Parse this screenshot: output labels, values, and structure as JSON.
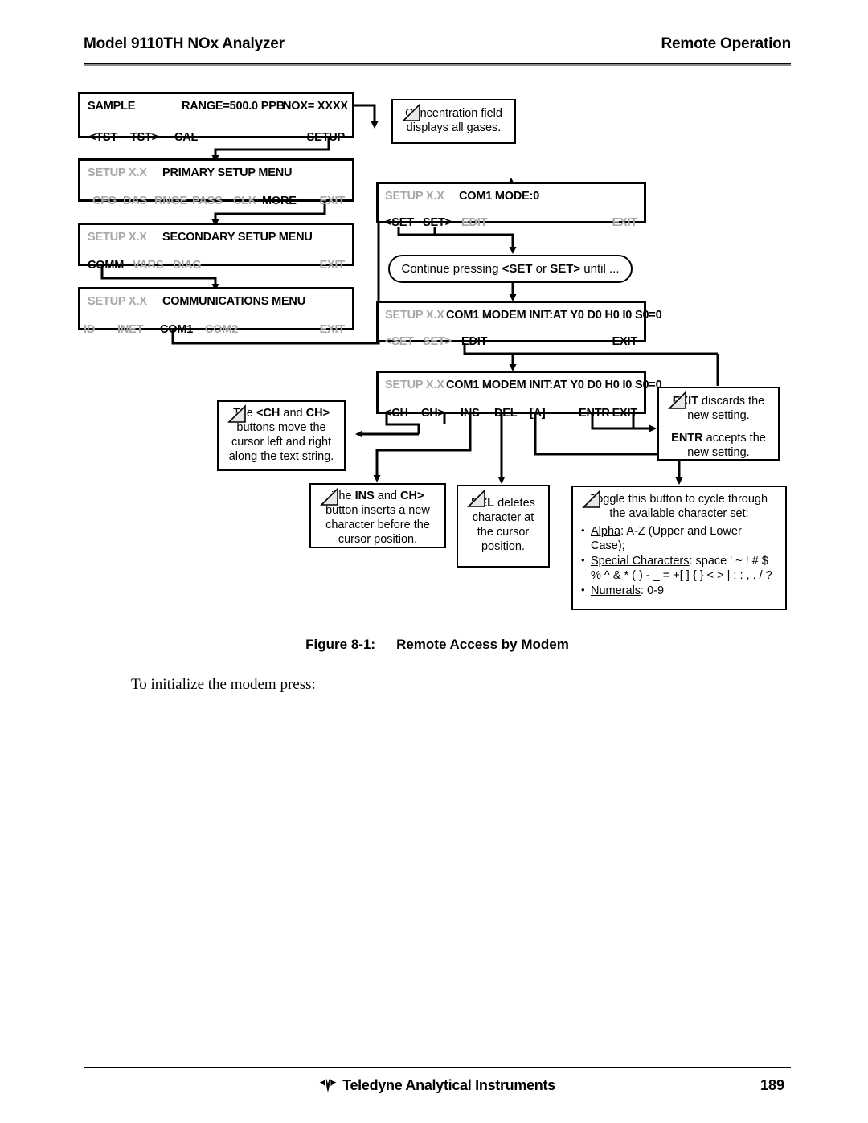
{
  "header": {
    "left_title": "Model 9110TH NOx Analyzer",
    "right_title": "Remote Operation"
  },
  "figure": {
    "displays": [
      {
        "id": "sample-display",
        "row1": [
          {
            "text": "SAMPLE",
            "state": "on"
          },
          {
            "text": "RANGE=500.0 PPB",
            "state": "on"
          },
          {
            "text": "NOX= XXXX",
            "state": "on"
          }
        ],
        "row2": [
          {
            "text": "<TST",
            "state": "on"
          },
          {
            "text": "TST>",
            "state": "on"
          },
          {
            "text": "CAL",
            "state": "on"
          },
          {
            "text": "SETUP",
            "state": "on"
          }
        ]
      },
      {
        "id": "primary-setup-menu",
        "row1": [
          {
            "text": "SETUP X.X",
            "state": "off"
          },
          {
            "text": "PRIMARY SETUP MENU",
            "state": "on"
          }
        ],
        "row2": [
          {
            "text": "CFG",
            "state": "off"
          },
          {
            "text": "DAS",
            "state": "off"
          },
          {
            "text": "RNGE",
            "state": "off"
          },
          {
            "text": "PASS",
            "state": "off"
          },
          {
            "text": "CLK",
            "state": "off"
          },
          {
            "text": "MORE",
            "state": "on"
          },
          {
            "text": "EXIT",
            "state": "off"
          }
        ]
      },
      {
        "id": "secondary-setup-menu",
        "row1": [
          {
            "text": "SETUP X.X",
            "state": "off"
          },
          {
            "text": "SECONDARY SETUP MENU",
            "state": "on"
          }
        ],
        "row2": [
          {
            "text": "COMM",
            "state": "on"
          },
          {
            "text": "VARS",
            "state": "off"
          },
          {
            "text": "DIAG",
            "state": "off"
          },
          {
            "text": "EXIT",
            "state": "off"
          }
        ]
      },
      {
        "id": "communications-menu",
        "row1": [
          {
            "text": "SETUP X.X",
            "state": "off"
          },
          {
            "text": "COMMUNICATIONS MENU",
            "state": "on"
          }
        ],
        "row2": [
          {
            "text": "ID",
            "state": "off"
          },
          {
            "text": "INET",
            "state": "off"
          },
          {
            "text": "COM1",
            "state": "on"
          },
          {
            "text": "COM2",
            "state": "off"
          },
          {
            "text": "EXIT",
            "state": "off"
          }
        ]
      },
      {
        "id": "com1-mode-display",
        "row1": [
          {
            "text": "SETUP X.X",
            "state": "off"
          },
          {
            "text": "COM1 MODE:0",
            "state": "on"
          }
        ],
        "row2": [
          {
            "text": "<SET",
            "state": "on"
          },
          {
            "text": "SET>",
            "state": "on"
          },
          {
            "text": "EDIT",
            "state": "off"
          },
          {
            "text": "EXIT",
            "state": "off"
          }
        ]
      },
      {
        "id": "com1-modem-init-display",
        "row1": [
          {
            "text": "SETUP X.X",
            "state": "off"
          },
          {
            "text": "COM1 MODEM INIT:AT Y0 D0 H0 I0 S0=0",
            "state": "on"
          }
        ],
        "row2": [
          {
            "text": "<SET",
            "state": "off"
          },
          {
            "text": "SET>",
            "state": "off"
          },
          {
            "text": "EDIT",
            "state": "on"
          },
          {
            "text": "EXIT",
            "state": "on"
          }
        ]
      },
      {
        "id": "com1-modem-init-edit-display",
        "row1": [
          {
            "text": "SETUP X.X",
            "state": "off"
          },
          {
            "text": "COM1 MODEM INIT:AT Y0 D0 H0 I0 S0=0",
            "state": "on"
          }
        ],
        "row2": [
          {
            "text": "<CH",
            "state": "on"
          },
          {
            "text": "CH>",
            "state": "on"
          },
          {
            "text": "INS",
            "state": "on"
          },
          {
            "text": "DEL",
            "state": "on"
          },
          {
            "text": "[A]",
            "state": "on"
          },
          {
            "text": "ENTR",
            "state": "on"
          },
          {
            "text": "EXIT",
            "state": "on"
          }
        ]
      }
    ],
    "notes": {
      "concentration": {
        "line1": "Concentration field",
        "line2": "displays all gases."
      },
      "continue_pressing": {
        "pre": "Continue pressing ",
        "b1": "<SET",
        "mid": " or ",
        "b2": "SET>",
        "post": " until ..."
      },
      "ch_buttons": {
        "pre": "The ",
        "b1": "<CH",
        "mid": " and ",
        "b2": "CH>",
        "post": " buttons move the cursor left and right along the text string."
      },
      "ins_button": {
        "pre": "The ",
        "b1": "INS",
        "mid": " and ",
        "b2": "CH>",
        "post": " button inserts a new character before the cursor position."
      },
      "del_button": {
        "b1": "DEL",
        "post": " deletes character at the cursor position."
      },
      "exit_entr": {
        "b1": "EXIT",
        "l1": " discards the new setting.",
        "b2": "ENTR",
        "l2": " accepts the new setting."
      },
      "charset": {
        "header_line1": "Toggle this button to cycle through",
        "header_line2": "the available character set:",
        "items": [
          {
            "label": "Alpha",
            "value": ": A-Z (Upper and Lower Case);"
          },
          {
            "label": "Special Characters",
            "value": ": space ' ~ ! # $ % ^ & * ( ) - _ = +[ ] { } < > | ; : , . / ?"
          },
          {
            "label": "Numerals",
            "value": ": 0-9"
          }
        ]
      }
    }
  },
  "caption": {
    "number": "Figure 8-1:",
    "title": "Remote Access by Modem"
  },
  "body": {
    "paragraph": "To initialize the modem press:"
  },
  "footer": {
    "company": "Teledyne Analytical Instruments",
    "page_number": "189"
  }
}
